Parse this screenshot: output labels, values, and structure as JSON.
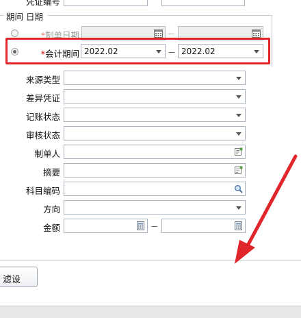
{
  "header": {
    "top_label": "凭证编号"
  },
  "period_group": {
    "title": "期间 日期"
  },
  "date_row": {
    "required_mark": "*",
    "label": "制单日期",
    "from": "",
    "to": "",
    "dash": "－"
  },
  "period_row": {
    "required_mark": "*",
    "label": "会计期间",
    "from": "2022.02",
    "to": "2022.02",
    "dash": "－"
  },
  "fields": {
    "source_type": {
      "label": "来源类型",
      "value": ""
    },
    "diff_voucher": {
      "label": "差异凭证",
      "value": ""
    },
    "post_status": {
      "label": "记账状态",
      "value": ""
    },
    "audit_status": {
      "label": "审核状态",
      "value": ""
    },
    "creator": {
      "label": "制单人",
      "value": ""
    },
    "summary": {
      "label": "摘要",
      "value": ""
    },
    "account_code": {
      "label": "科目编码",
      "value": ""
    },
    "direction": {
      "label": "方向",
      "value": ""
    },
    "amount": {
      "label": "金额",
      "from": "",
      "to": "",
      "dash": "－"
    }
  },
  "footer": {
    "filter_button": "滤设"
  },
  "colors": {
    "highlight": "#e0252b",
    "arrow": "#e0252b"
  }
}
